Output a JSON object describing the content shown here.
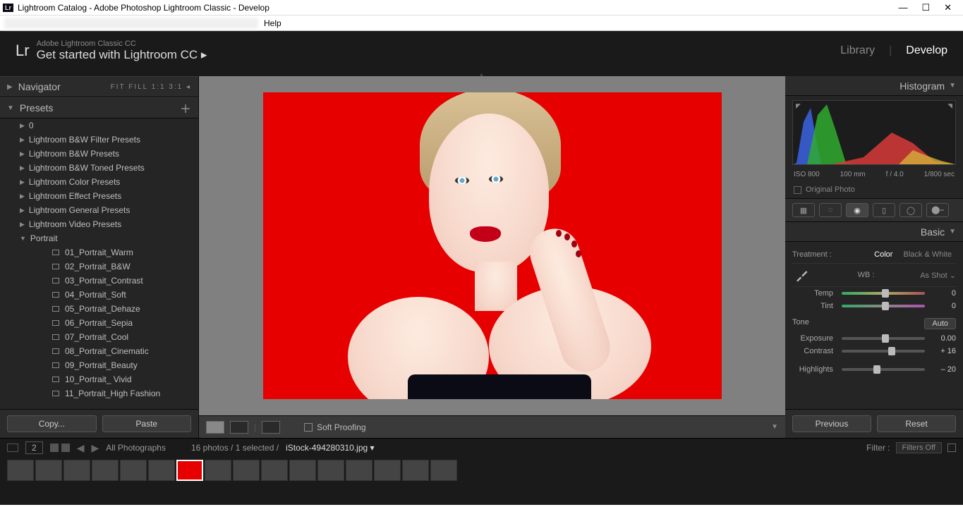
{
  "window": {
    "title": "Lightroom Catalog - Adobe Photoshop Lightroom Classic - Develop",
    "menu_help": "Help"
  },
  "header": {
    "brand": "Lr",
    "sub": "Adobe Lightroom Classic CC",
    "main": "Get started with Lightroom CC  ▸",
    "module_library": "Library",
    "module_develop": "Develop"
  },
  "left": {
    "navigator": "Navigator",
    "nav_modes": "FIT   FILL   1:1   3:1 ◂",
    "presets": "Presets",
    "groups": [
      "0",
      "Lightroom B&W Filter Presets",
      "Lightroom B&W Presets",
      "Lightroom B&W Toned Presets",
      "Lightroom Color Presets",
      "Lightroom Effect Presets",
      "Lightroom General Presets",
      "Lightroom Video Presets"
    ],
    "expanded_group": "Portrait",
    "items": [
      "01_Portrait_Warm",
      "02_Portrait_B&W",
      "03_Portrait_Contrast",
      "04_Portrait_Soft",
      "05_Portrait_Dehaze",
      "06_Portrait_Sepia",
      "07_Portrait_Cool",
      "08_Portrait_Cinematic",
      "09_Portrait_Beauty",
      "10_Portrait_ Vivid",
      "11_Portrait_High Fashion"
    ],
    "copy_btn": "Copy...",
    "paste_btn": "Paste"
  },
  "center": {
    "soft_proofing": "Soft Proofing"
  },
  "right": {
    "histogram": "Histogram",
    "iso": "ISO 800",
    "focal": "100 mm",
    "aperture": "f / 4.0",
    "shutter": "1/800 sec",
    "original_photo": "Original Photo",
    "basic": "Basic",
    "treatment": "Treatment :",
    "color": "Color",
    "bw": "Black & White",
    "wb": "WB :",
    "wb_sel": "As Shot ⌄",
    "temp": "Temp",
    "tint": "Tint",
    "tone": "Tone",
    "auto": "Auto",
    "exposure": "Exposure",
    "contrast": "Contrast",
    "highlights": "Highlights",
    "val_temp": "0",
    "val_tint": "0",
    "val_exposure": "0.00",
    "val_contrast": "+ 16",
    "val_highlights": "– 20",
    "previous": "Previous",
    "reset": "Reset"
  },
  "filmstrip": {
    "page": "2",
    "collection": "All Photographs",
    "count_sel": "16 photos / 1 selected /",
    "filename": "iStock-494280310.jpg",
    "filter_label": "Filter :",
    "filters_off": "Filters Off"
  }
}
